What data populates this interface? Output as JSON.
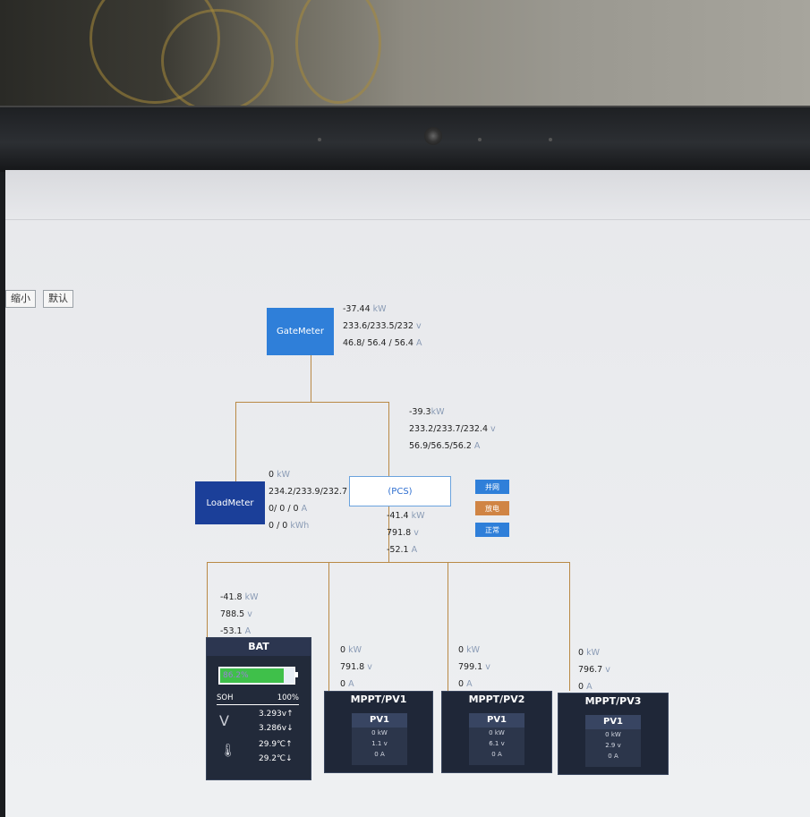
{
  "toolbar": {
    "zoom_out": "缩小",
    "reset": "默认"
  },
  "gate_meter": {
    "label": "GateMeter",
    "power": "-37.44",
    "power_unit": "kW",
    "voltage": "233.6/233.5/232",
    "voltage_unit": "v",
    "current": "46.8/ 56.4 / 56.4",
    "current_unit": "A"
  },
  "grid_link": {
    "power": "-39.3",
    "power_unit": "kW",
    "voltage": "233.2/233.7/232.4",
    "voltage_unit": "v",
    "current": "56.9/56.5/56.2",
    "current_unit": "A"
  },
  "load_meter": {
    "label": "LoadMeter",
    "power": "0",
    "power_unit": "kW",
    "voltage": "234.2/233.9/232.7",
    "voltage_unit": "v",
    "current": "0/ 0 / 0",
    "current_unit": "A",
    "energy": "0 / 0",
    "energy_unit": "kWh"
  },
  "pcs": {
    "label": "(PCS)",
    "power": "-41.4",
    "power_unit": "kW",
    "voltage": "791.8",
    "voltage_unit": "v",
    "current": "-52.1",
    "current_unit": "A",
    "tags": [
      "并网",
      "放电",
      "正常"
    ]
  },
  "colors": {
    "tag_grid": "#2f7fd9",
    "tag_discharge": "#d08444",
    "tag_normal": "#2f7fd9",
    "line": "#b98945"
  },
  "battery": {
    "link_power": "-41.8",
    "link_voltage": "788.5",
    "link_current": "-53.1",
    "title": "BAT",
    "soc": "86.2%",
    "soc_value": 86.2,
    "soh_label": "SOH",
    "soh_value": "100%",
    "v_icon": "V",
    "v_max": "3.293v↑",
    "v_min": "3.286v↓",
    "t_max": "29.9℃↑",
    "t_min": "29.2℃↓"
  },
  "mppt": [
    {
      "link_power": "0",
      "link_voltage": "791.8",
      "link_current": "0",
      "title": "MPPT/PV1",
      "pv": "PV1",
      "pv_power": "0 kW",
      "pv_voltage": "1.1 v",
      "pv_current": "0 A"
    },
    {
      "link_power": "0",
      "link_voltage": "799.1",
      "link_current": "0",
      "title": "MPPT/PV2",
      "pv": "PV1",
      "pv_power": "0 kW",
      "pv_voltage": "6.1 v",
      "pv_current": "0 A"
    },
    {
      "link_power": "0",
      "link_voltage": "796.7",
      "link_current": "0",
      "title": "MPPT/PV3",
      "pv": "PV1",
      "pv_power": "0 kW",
      "pv_voltage": "2.9 v",
      "pv_current": "0 A"
    }
  ],
  "units": {
    "kw": "kW",
    "v": "v",
    "a": "A"
  }
}
